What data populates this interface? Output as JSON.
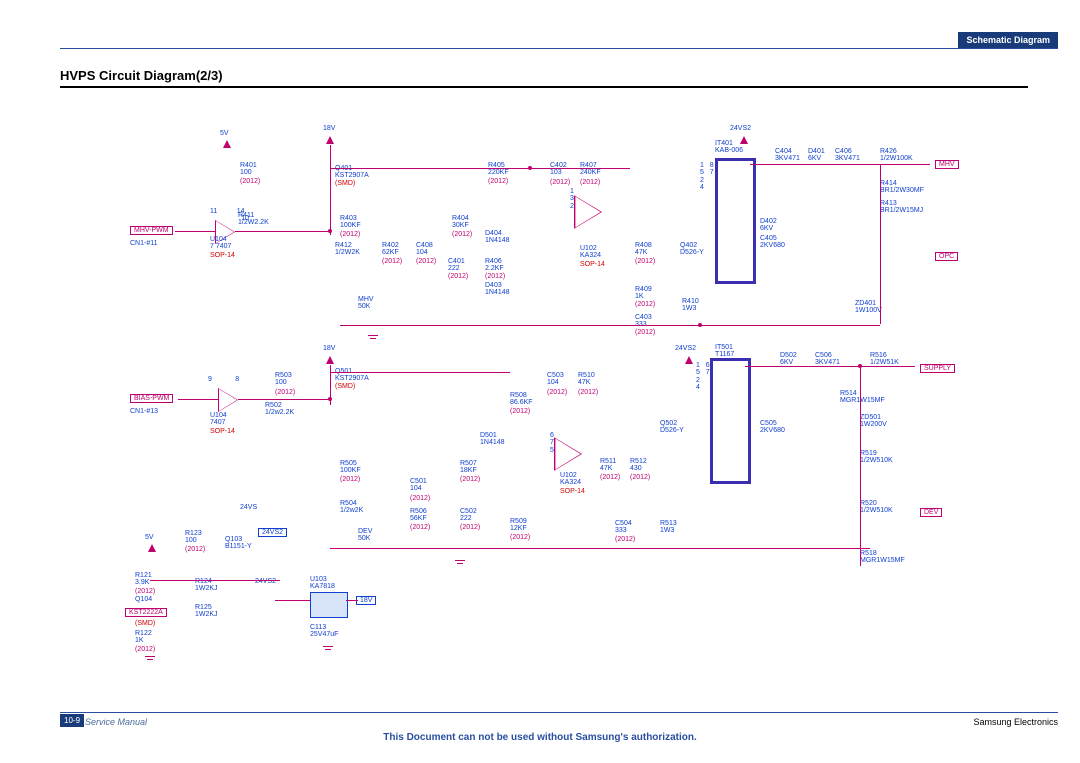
{
  "header": {
    "tab": "Schematic Diagram",
    "title": "HVPS Circuit Diagram(2/3)"
  },
  "footer": {
    "page_badge": "10-9",
    "left": "Service Manual",
    "center": "This Document can not be used without Samsung's authorization.",
    "right": "Samsung Electronics"
  },
  "tags": {
    "mhv_pwm": "MHV-PWM",
    "bias_pwm": "BIAS-PWM",
    "vs24_2": "24VS2",
    "v18": "18V",
    "mhv": "MHV",
    "opc": "OPC",
    "supply": "SUPPLY",
    "dev": "DEV",
    "cn1_11": "CN1-#11",
    "cn1_13": "CN1-#13",
    "smd": "(SMD)",
    "sop14": "SOP-14",
    "pkg": "(2012)",
    "kst2222a": "KST2222A"
  },
  "rails": {
    "v5": "5V",
    "v18": "18V",
    "v24vs": "24VS",
    "v24vs2": "24VS2"
  },
  "upper": {
    "R401": "R401\n100",
    "R411": "R411\n1/2W2.2K",
    "U104": "U104\n7 7407",
    "pins": "11          14\n                10",
    "Q401": "Q401\nKST2907A",
    "R403": "R403\n100KF",
    "R412": "R412\n1/2W2K",
    "MHV50K": "MHV\n50K",
    "R402": "R402\n62KF",
    "C408": "C408\n104",
    "R404": "R404\n30KF",
    "C401": "C401\n222",
    "R405": "R405\n220KF",
    "D404": "D404\n1N4148",
    "R406": "R406\n2.2KF",
    "D403": "D403\n1N4148",
    "C402": "C402\n103",
    "R407": "R407\n240KF",
    "U102": "U102\nKA324",
    "U102pins": "1\n3\n2",
    "R408": "R408\n47K",
    "R409": "R409\n1K",
    "C403": "C403\n333",
    "Q402": "Q402\nD526-Y",
    "R410": "R410\n1W3",
    "IT401": "IT401\nKAB-006",
    "IT401pins": "1   8\n5   7\n2\n4",
    "C404": "C404\n3KV471",
    "D401": "D401\n6KV",
    "C406": "C406\n3KV471",
    "D402": "D402\n6KV",
    "C405": "C405\n2KV680",
    "R426": "R426\n1/2W100K",
    "R414": "R414\nBR1/2W30MF",
    "R413": "R413\nBR1/2W15MJ",
    "ZD401": "ZD401\n1W100V"
  },
  "lower": {
    "R503": "R503\n100",
    "R502": "R502\n1/2w2.2K",
    "U104": "U104\n7407",
    "pins": "9            8",
    "Q501": "Q501\nKST2907A",
    "R505": "R505\n100KF",
    "R504": "R504\n1/2w2K",
    "DEV50K": "DEV\n50K",
    "C501": "C501\n104",
    "R506": "R506\n56KF",
    "R507": "R507\n18KF",
    "C502": "C502\n222",
    "R508": "R508\n86.6KF",
    "R509": "R509\n12KF",
    "D501": "D501\n1N4148",
    "C503": "C503\n104",
    "R510": "R510\n47K",
    "U102": "U102\nKA324",
    "U102pins": "6\n7\n5",
    "R511": "R511\n47K",
    "R512": "R512\n430",
    "C504": "C504\n333",
    "R513": "R513\n1W3",
    "Q502": "Q502\nD526-Y",
    "IT501": "IT501\nT1167",
    "IT501pins": "1   6\n5   7\n2\n4",
    "D502": "D502\n6KV",
    "C506": "C506\n3KV471",
    "C505": "C505\n2KV680",
    "R516": "R516\n1/2W51K",
    "R514": "R514\nMGR1W15MF",
    "ZD501": "ZD501\n1W200V",
    "R519": "R519\n1/2W510K",
    "R520": "R520\n1/2W510K",
    "R518": "R518\nMGR1W15MF"
  },
  "aux": {
    "R121": "R121\n3.9K",
    "R122": "R122\n1K",
    "R123": "R123\n100",
    "R124": "R124\n1W2KJ",
    "R125": "R125\n1W2KJ",
    "Q103": "Q103\nB1151-Y",
    "Q104": "Q104",
    "U103": "U103\nKA7818",
    "C113": "C113\n25V47uF"
  }
}
